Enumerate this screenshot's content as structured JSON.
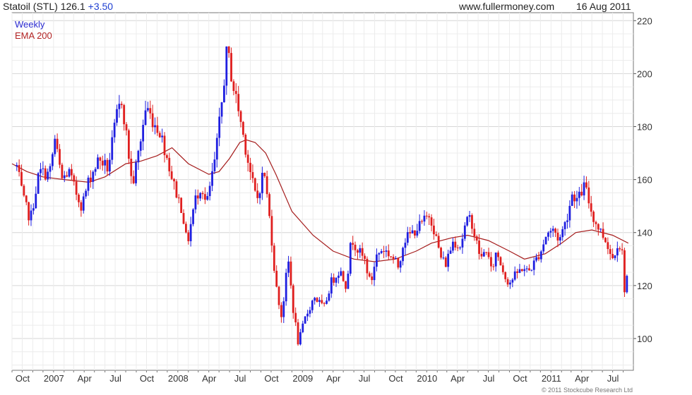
{
  "header": {
    "symbol_label": "Statoil (STL)",
    "last_price": "126.1",
    "change": "+3.50",
    "website": "www.fullermoney.com",
    "date": "16 Aug 2011"
  },
  "legend": {
    "weekly": "Weekly",
    "ema": "EMA 200"
  },
  "credit": "© 2011 Stockcube Research Ltd",
  "colors": {
    "up_candle": "#1f1fe0",
    "down_candle": "#e01f1f",
    "ema_line": "#a51c1c",
    "grid": "#dcdcdc"
  },
  "chart_data": {
    "type": "candlestick",
    "title": "Statoil (STL) 126.1 +3.50",
    "ylim": [
      88,
      223
    ],
    "y_ticks": [
      100,
      120,
      140,
      160,
      180,
      200,
      220
    ],
    "x_ticks": [
      "Oct",
      "2007",
      "Apr",
      "Jul",
      "Oct",
      "2008",
      "Apr",
      "Jul",
      "Oct",
      "2009",
      "Apr",
      "Jul",
      "Oct",
      "2010",
      "Apr",
      "Jul",
      "Oct",
      "2011",
      "Apr",
      "Jul"
    ],
    "x_start": "2006-09-01",
    "x_end": "2011-08-31",
    "series": [
      {
        "name": "Weekly",
        "style": "candlestick",
        "key_points": [
          [
            "2006-09-15",
            165
          ],
          [
            "2006-10-05",
            152
          ],
          [
            "2006-10-25",
            145
          ],
          [
            "2006-11-20",
            163
          ],
          [
            "2006-12-20",
            162
          ],
          [
            "2007-01-05",
            175
          ],
          [
            "2007-01-25",
            160
          ],
          [
            "2007-02-15",
            163
          ],
          [
            "2007-03-05",
            156
          ],
          [
            "2007-03-25",
            150
          ],
          [
            "2007-04-15",
            160
          ],
          [
            "2007-05-15",
            168
          ],
          [
            "2007-06-10",
            164
          ],
          [
            "2007-07-05",
            184
          ],
          [
            "2007-07-20",
            190
          ],
          [
            "2007-08-05",
            175
          ],
          [
            "2007-08-20",
            157
          ],
          [
            "2007-09-10",
            172
          ],
          [
            "2007-09-30",
            188
          ],
          [
            "2007-10-20",
            182
          ],
          [
            "2007-11-10",
            178
          ],
          [
            "2007-12-01",
            168
          ],
          [
            "2007-12-20",
            158
          ],
          [
            "2008-01-15",
            148
          ],
          [
            "2008-01-28",
            135
          ],
          [
            "2008-02-20",
            152
          ],
          [
            "2008-03-10",
            158
          ],
          [
            "2008-03-25",
            150
          ],
          [
            "2008-04-20",
            168
          ],
          [
            "2008-05-10",
            190
          ],
          [
            "2008-05-25",
            210
          ],
          [
            "2008-06-10",
            196
          ],
          [
            "2008-06-25",
            188
          ],
          [
            "2008-07-15",
            174
          ],
          [
            "2008-08-05",
            160
          ],
          [
            "2008-08-20",
            152
          ],
          [
            "2008-09-10",
            164
          ],
          [
            "2008-10-01",
            140
          ],
          [
            "2008-10-15",
            120
          ],
          [
            "2008-11-01",
            108
          ],
          [
            "2008-11-20",
            130
          ],
          [
            "2008-12-05",
            111
          ],
          [
            "2008-12-20",
            98
          ],
          [
            "2009-01-10",
            108
          ],
          [
            "2009-02-05",
            116
          ],
          [
            "2009-03-05",
            111
          ],
          [
            "2009-03-25",
            121
          ],
          [
            "2009-04-20",
            126
          ],
          [
            "2009-05-10",
            120
          ],
          [
            "2009-05-25",
            138
          ],
          [
            "2009-06-15",
            133
          ],
          [
            "2009-07-05",
            129
          ],
          [
            "2009-07-20",
            120
          ],
          [
            "2009-08-05",
            131
          ],
          [
            "2009-08-25",
            134
          ],
          [
            "2009-09-20",
            131
          ],
          [
            "2009-10-10",
            127
          ],
          [
            "2009-10-25",
            137
          ],
          [
            "2009-11-20",
            140
          ],
          [
            "2009-12-15",
            143
          ],
          [
            "2010-01-10",
            147
          ],
          [
            "2010-01-25",
            140
          ],
          [
            "2010-02-10",
            131
          ],
          [
            "2010-02-25",
            128
          ],
          [
            "2010-03-20",
            137
          ],
          [
            "2010-04-10",
            135
          ],
          [
            "2010-04-25",
            143
          ],
          [
            "2010-05-10",
            146
          ],
          [
            "2010-05-25",
            137
          ],
          [
            "2010-06-10",
            130
          ],
          [
            "2010-06-25",
            134
          ],
          [
            "2010-07-10",
            125
          ],
          [
            "2010-07-25",
            133
          ],
          [
            "2010-08-15",
            125
          ],
          [
            "2010-08-30",
            121
          ],
          [
            "2010-09-20",
            124
          ],
          [
            "2010-10-10",
            127
          ],
          [
            "2010-10-25",
            125
          ],
          [
            "2010-11-15",
            129
          ],
          [
            "2010-12-05",
            134
          ],
          [
            "2010-12-20",
            140
          ],
          [
            "2011-01-10",
            141
          ],
          [
            "2011-01-25",
            137
          ],
          [
            "2011-02-15",
            145
          ],
          [
            "2011-03-05",
            155
          ],
          [
            "2011-03-20",
            152
          ],
          [
            "2011-04-10",
            158
          ],
          [
            "2011-04-25",
            150
          ],
          [
            "2011-05-10",
            144
          ],
          [
            "2011-05-25",
            141
          ],
          [
            "2011-06-15",
            136
          ],
          [
            "2011-06-30",
            130
          ],
          [
            "2011-07-15",
            136
          ],
          [
            "2011-07-28",
            134
          ],
          [
            "2011-08-05",
            119
          ],
          [
            "2011-08-16",
            126.1
          ]
        ]
      },
      {
        "name": "EMA 200",
        "style": "line",
        "points": [
          [
            "2006-09-01",
            166
          ],
          [
            "2006-10-15",
            163
          ],
          [
            "2006-12-01",
            161
          ],
          [
            "2007-02-01",
            160
          ],
          [
            "2007-04-15",
            159
          ],
          [
            "2007-06-01",
            161
          ],
          [
            "2007-08-01",
            166
          ],
          [
            "2007-09-15",
            167
          ],
          [
            "2007-11-01",
            169
          ],
          [
            "2007-12-15",
            172
          ],
          [
            "2008-02-01",
            166
          ],
          [
            "2008-04-01",
            162
          ],
          [
            "2008-05-01",
            163
          ],
          [
            "2008-06-01",
            168
          ],
          [
            "2008-07-01",
            174
          ],
          [
            "2008-07-20",
            175
          ],
          [
            "2008-08-15",
            174
          ],
          [
            "2008-09-15",
            170
          ],
          [
            "2008-10-15",
            162
          ],
          [
            "2008-12-01",
            148
          ],
          [
            "2009-02-01",
            139
          ],
          [
            "2009-04-01",
            133
          ],
          [
            "2009-06-01",
            130
          ],
          [
            "2009-08-01",
            129
          ],
          [
            "2009-10-01",
            130
          ],
          [
            "2009-12-01",
            133
          ],
          [
            "2010-01-15",
            136
          ],
          [
            "2010-03-15",
            138
          ],
          [
            "2010-05-01",
            139
          ],
          [
            "2010-07-01",
            137
          ],
          [
            "2010-09-01",
            133
          ],
          [
            "2010-10-15",
            130
          ],
          [
            "2010-12-15",
            132
          ],
          [
            "2011-02-01",
            136
          ],
          [
            "2011-03-15",
            140
          ],
          [
            "2011-05-01",
            141
          ],
          [
            "2011-07-01",
            139
          ],
          [
            "2011-08-16",
            136
          ]
        ]
      }
    ]
  }
}
